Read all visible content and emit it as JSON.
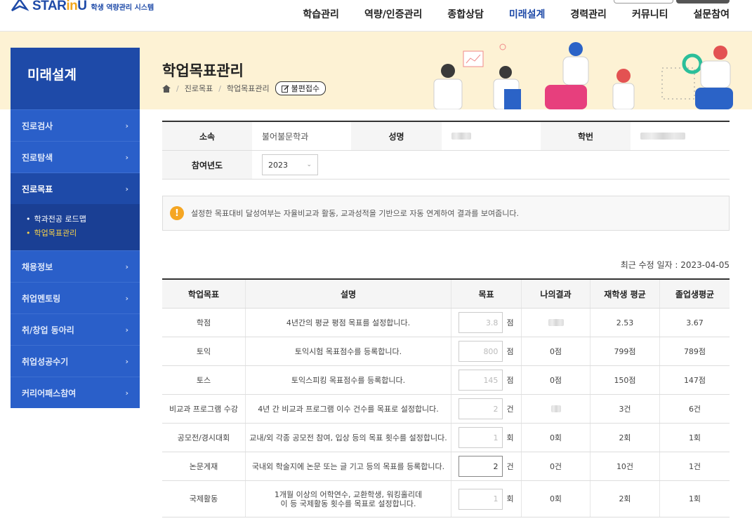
{
  "logo": {
    "brand_a": "STAR",
    "brand_b": "in",
    "brand_c": "U",
    "subtitle": "학생 역량관리 시스템"
  },
  "nav": [
    "학습관리",
    "역량/인증관리",
    "종합상담",
    "미래설계",
    "경력관리",
    "커뮤니티",
    "설문참여"
  ],
  "nav_active": "미래설계",
  "banner": {
    "title": "학업목표관리",
    "crumbs": [
      "진로목표",
      "학업목표관리"
    ],
    "complaint": "불편접수"
  },
  "sidebar": {
    "title": "미래설계",
    "items": [
      {
        "label": "진로검사"
      },
      {
        "label": "진로탐색"
      },
      {
        "label": "진로목표"
      },
      {
        "label": "채용정보"
      },
      {
        "label": "취업멘토링"
      },
      {
        "label": "취/창업 동아리"
      },
      {
        "label": "취업성공수기"
      },
      {
        "label": "커리어패스참여"
      }
    ],
    "sub": [
      "학과전공 로드맵",
      "학업목표관리"
    ]
  },
  "info": {
    "dept_label": "소속",
    "dept_value": "불어불문학과",
    "name_label": "성명",
    "id_label": "학번",
    "year_label": "참여년도",
    "year_value": "2023"
  },
  "notice": "설정한 목표대비 달성여부는 자율비교과 활동, 교과성적을 기반으로 자동 연계하여 결과를 보여줍니다.",
  "modified": "최근 수정 일자 : 2023-04-05",
  "table": {
    "headers": [
      "학업목표",
      "설명",
      "목표",
      "나의결과",
      "재학생 평균",
      "졸업생평균"
    ],
    "rows": [
      {
        "goal": "학점",
        "desc": "4년간의 평균 평점 목표를 설정합니다.",
        "target": "3.8",
        "unit": "점",
        "mine": "",
        "cur_avg": "2.53",
        "grad_avg": "3.67"
      },
      {
        "goal": "토익",
        "desc": "토익시험 목표점수를 등록합니다.",
        "target": "800",
        "unit": "점",
        "mine": "0점",
        "cur_avg": "799점",
        "grad_avg": "789점"
      },
      {
        "goal": "토스",
        "desc": "토익스피킹 목표점수를 등록합니다.",
        "target": "145",
        "unit": "점",
        "mine": "0점",
        "cur_avg": "150점",
        "grad_avg": "147점"
      },
      {
        "goal": "비교과 프로그램 수강",
        "desc": "4년 간 비교과 프로그램 이수 건수를 목표로 설정합니다.",
        "target": "2",
        "unit": "건",
        "mine": "",
        "cur_avg": "3건",
        "grad_avg": "6건"
      },
      {
        "goal": "공모전/경시대회",
        "desc": "교내/외 각종 공모전 참여, 입상 등의 목표 횟수를 설정합니다.",
        "target": "1",
        "unit": "회",
        "mine": "0회",
        "cur_avg": "2회",
        "grad_avg": "1회"
      },
      {
        "goal": "논문게재",
        "desc": "국내외 학술지에 논문 또는 글 기고 등의 목표를 등록합니다.",
        "target": "2",
        "unit": "건",
        "mine": "0건",
        "cur_avg": "10건",
        "grad_avg": "1건"
      },
      {
        "goal": "국제활동",
        "desc": "1개월 이상의 어학연수, 교환학생, 워킹홀리데이 등 국제활동 횟수를 목표로 설정합니다.",
        "target": "1",
        "unit": "회",
        "mine": "0회",
        "cur_avg": "2회",
        "grad_avg": "1회"
      }
    ]
  },
  "colors": {
    "primary": "#1e4aa8",
    "sidebar": "#2a5fc9",
    "banner": "#fdf2d4",
    "highlight": "#f7d24a",
    "notice_icon": "#f5a623"
  }
}
